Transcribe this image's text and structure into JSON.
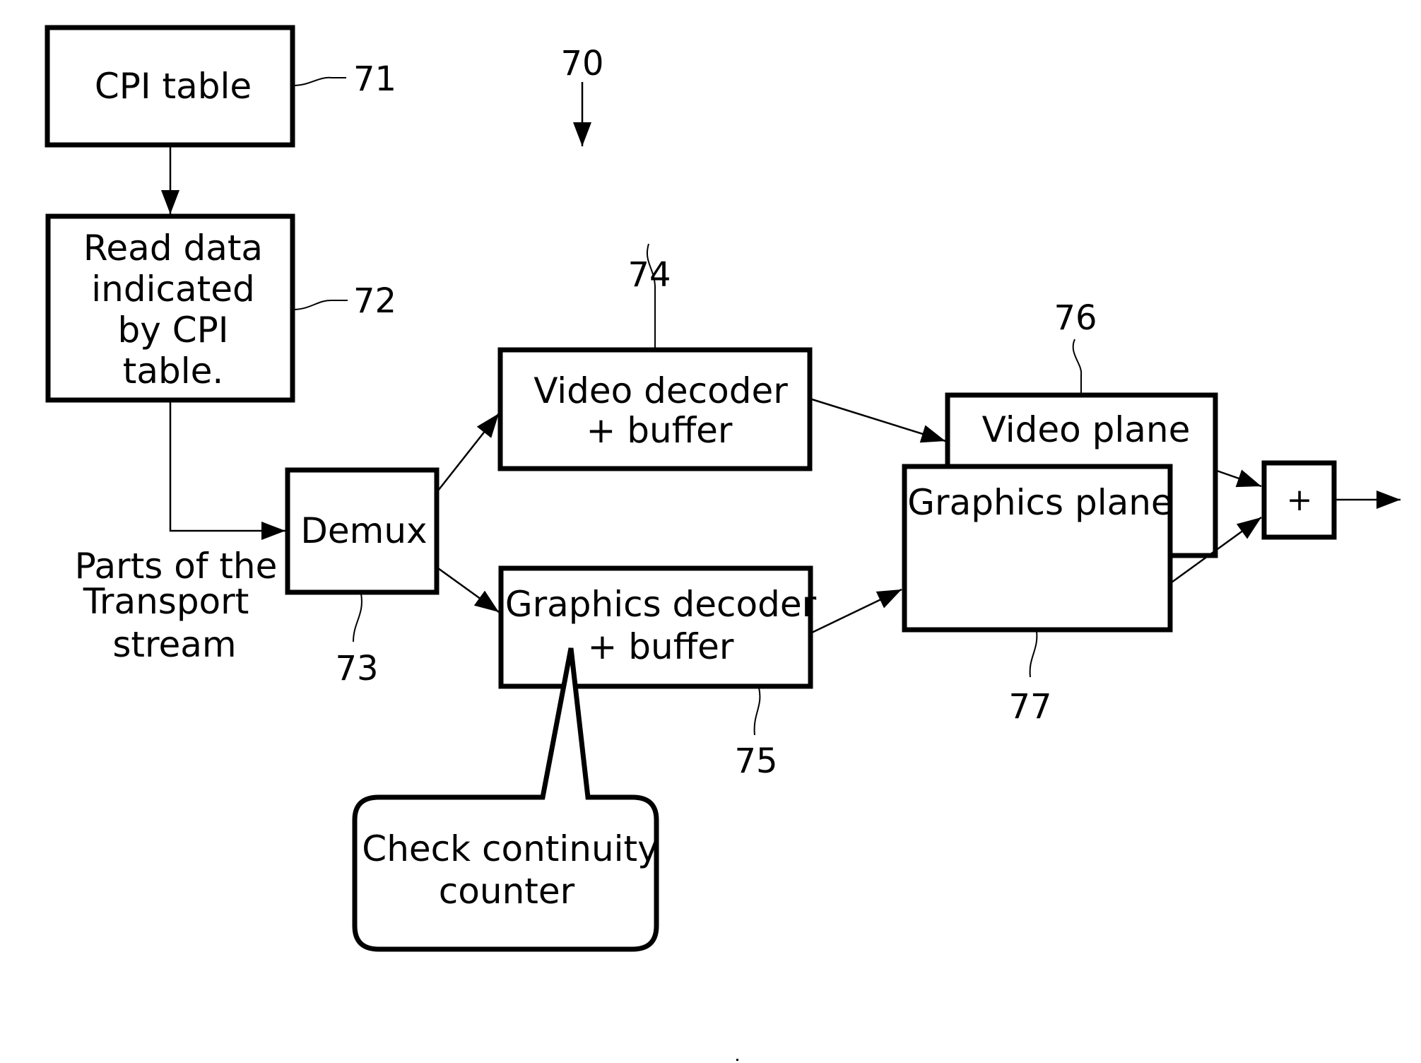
{
  "figure": {
    "reference": "70",
    "colors": {
      "ink": "#000000",
      "paper": "#ffffff"
    }
  },
  "blocks": {
    "cpi_table": {
      "ref": "71",
      "lines": [
        "CPI table"
      ]
    },
    "read_data": {
      "ref": "72",
      "lines": [
        "Read data",
        "indicated",
        "by CPI",
        "table."
      ]
    },
    "demux": {
      "ref": "73",
      "lines": [
        "Demux"
      ]
    },
    "video_decoder": {
      "ref": "74",
      "lines": [
        "Video decoder",
        "+ buffer"
      ]
    },
    "graphics_decoder": {
      "ref": "75",
      "lines": [
        "Graphics decoder",
        "+ buffer"
      ]
    },
    "video_plane": {
      "ref": "76",
      "lines": [
        "Video plane"
      ]
    },
    "graphics_plane": {
      "ref": "77",
      "lines": [
        "Graphics plane"
      ]
    },
    "adder": {
      "lines": [
        "+"
      ]
    }
  },
  "annotations": {
    "transport_stream": {
      "lines": [
        "Parts of the",
        "Transport",
        "stream"
      ]
    },
    "continuity_callout": {
      "lines": [
        "Check continuity",
        "counter"
      ]
    }
  },
  "connections": [
    {
      "from": "cpi_table",
      "to": "read_data"
    },
    {
      "from": "read_data",
      "to": "demux"
    },
    {
      "from": "demux",
      "to": "video_decoder"
    },
    {
      "from": "demux",
      "to": "graphics_decoder"
    },
    {
      "from": "video_decoder",
      "to": "video_plane"
    },
    {
      "from": "graphics_decoder",
      "to": "graphics_plane"
    },
    {
      "from": "video_plane",
      "to": "adder"
    },
    {
      "from": "graphics_plane",
      "to": "adder"
    },
    {
      "from": "adder",
      "to": "output"
    }
  ]
}
